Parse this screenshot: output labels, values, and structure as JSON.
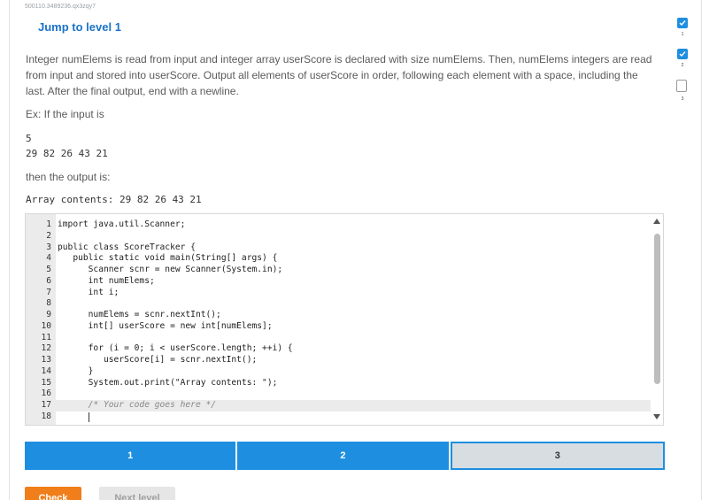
{
  "header": {
    "activity_id": "500110.3489236.qx3zqy7",
    "jump_link": "Jump to level 1"
  },
  "prompt": {
    "description": "Integer numElems is read from input and integer array userScore is declared with size numElems. Then, numElems integers are read from input and stored into userScore. Output all elements of userScore in order, following each element with a space, including the last. After the final output, end with a newline.",
    "example_label": "Ex: If the input is",
    "input_line1": "5",
    "input_line2": "29 82 26 43 21",
    "then_label": "then the output is:",
    "output_line1": "Array contents: 29 82 26 43 21"
  },
  "editor": {
    "lines": [
      {
        "n": "1",
        "code": "import java.util.Scanner;"
      },
      {
        "n": "2",
        "code": ""
      },
      {
        "n": "3",
        "code": "public class ScoreTracker {"
      },
      {
        "n": "4",
        "code": "   public static void main(String[] args) {"
      },
      {
        "n": "5",
        "code": "      Scanner scnr = new Scanner(System.in);"
      },
      {
        "n": "6",
        "code": "      int numElems;"
      },
      {
        "n": "7",
        "code": "      int i;"
      },
      {
        "n": "8",
        "code": ""
      },
      {
        "n": "9",
        "code": "      numElems = scnr.nextInt();"
      },
      {
        "n": "10",
        "code": "      int[] userScore = new int[numElems];"
      },
      {
        "n": "11",
        "code": ""
      },
      {
        "n": "12",
        "code": "      for (i = 0; i < userScore.length; ++i) {"
      },
      {
        "n": "13",
        "code": "         userScore[i] = scnr.nextInt();"
      },
      {
        "n": "14",
        "code": "      }"
      },
      {
        "n": "15",
        "code": "      System.out.print(\"Array contents: \");"
      },
      {
        "n": "16",
        "code": ""
      },
      {
        "n": "17",
        "code": "      /* Your code goes here */"
      },
      {
        "n": "18",
        "code": ""
      }
    ],
    "highlighted_line": 17
  },
  "levels": {
    "items": [
      {
        "label": "1",
        "state": "complete"
      },
      {
        "label": "2",
        "state": "complete"
      },
      {
        "label": "3",
        "state": "current"
      }
    ]
  },
  "actions": {
    "check_label": "Check",
    "next_label": "Next level"
  },
  "sidebar": {
    "markers": [
      {
        "label": "1",
        "state": "done"
      },
      {
        "label": "2",
        "state": "done"
      },
      {
        "label": "3",
        "state": "pending"
      }
    ]
  },
  "colors": {
    "accent": "#1e8fe0",
    "check_button": "#f07e1a",
    "link": "#1a73c8"
  }
}
